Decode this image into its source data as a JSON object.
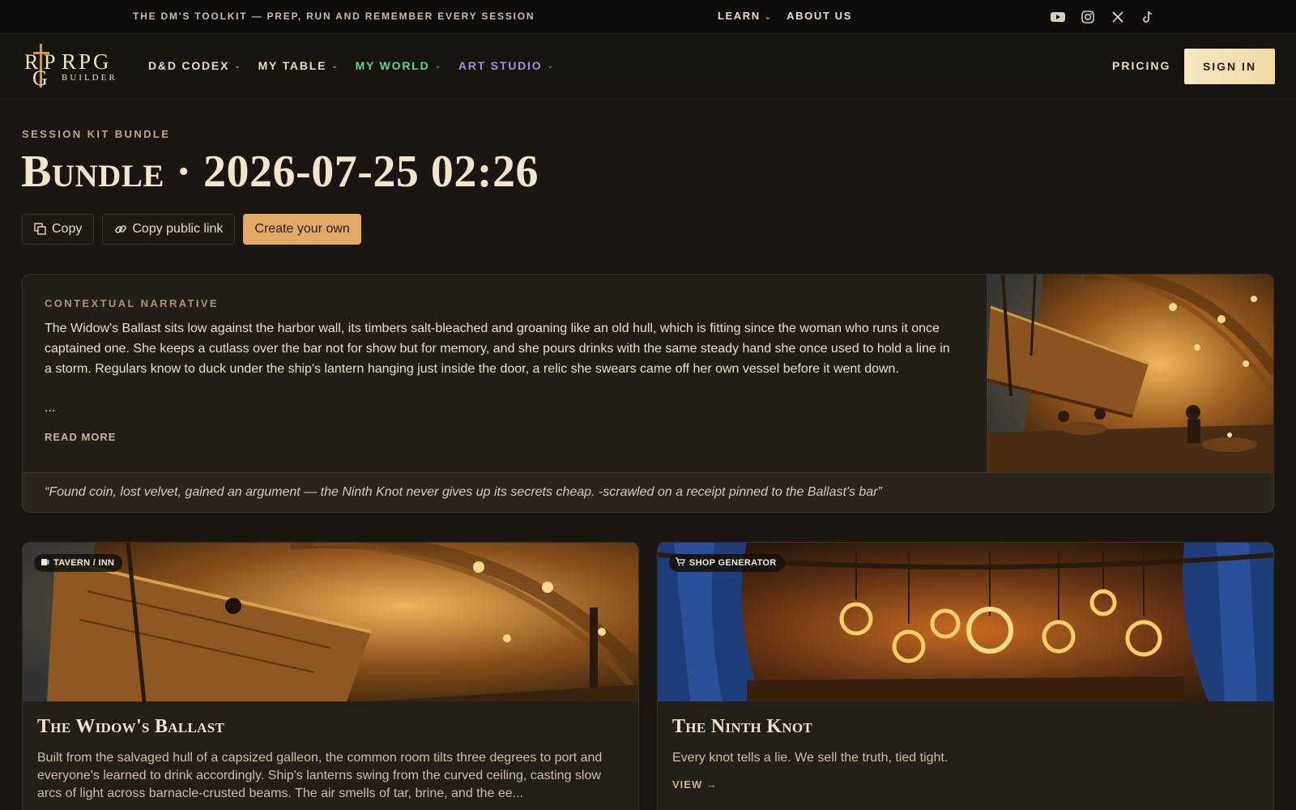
{
  "topbar": {
    "tagline": "THE DM'S TOOLKIT — PREP, RUN AND REMEMBER EVERY SESSION",
    "links": [
      "LEARN",
      "ABOUT US"
    ],
    "socials": [
      "youtube-icon",
      "instagram-icon",
      "x-icon",
      "tiktok-icon"
    ]
  },
  "nav": {
    "logo": {
      "mono": [
        "R",
        "P",
        "G"
      ],
      "word1": "RPG",
      "word2": "BUILDER"
    },
    "items": [
      {
        "label": "D&D CODEX",
        "color": "#e8dcc6"
      },
      {
        "label": "MY TABLE",
        "color": "#e8dcc6"
      },
      {
        "label": "MY WORLD",
        "color": "#6fcf8f"
      },
      {
        "label": "ART STUDIO",
        "color": "#a98fe0"
      }
    ],
    "pricing": "PRICING",
    "signin": "SIGN IN"
  },
  "header": {
    "kicker": "SESSION KIT BUNDLE",
    "title": "Bundle · 2026-07-25 02:26",
    "actions": {
      "copy": "Copy",
      "copy_link": "Copy public link",
      "create": "Create your own"
    }
  },
  "narrative": {
    "label": "CONTEXTUAL NARRATIVE",
    "body": "The Widow's Ballast sits low against the harbor wall, its timbers salt-bleached and groaning like an old hull, which is fitting since the woman who runs it once captained one. She keeps a cutlass over the bar not for show but for memory, and she pours drinks with the same steady hand she once used to hold a line in a storm. Regulars know to duck under the ship's lantern hanging just inside the door, a relic she swears came off her own vessel before it went down.",
    "ellipsis": "...",
    "read_more": "READ MORE",
    "quote": "“Found coin, lost velvet, gained an argument — the Ninth Knot never gives up its secrets cheap. -scrawled on a receipt pinned to the Ballast's bar”"
  },
  "cards": [
    {
      "badge": "TAVERN / INN",
      "badge_icon": "beer-mug-icon",
      "title": "The Widow's Ballast",
      "desc": "Built from the salvaged hull of a capsized galleon, the common room tilts three degrees to port and everyone's learned to drink accordingly. Ship's lanterns swing from the curved ceiling, casting slow arcs of light across barnacle-crusted beams. The air smells of tar, brine, and the ee..."
    },
    {
      "badge": "SHOP GENERATOR",
      "badge_icon": "cart-icon",
      "title": "The Ninth Knot",
      "desc": "Every knot tells a lie. We sell the truth, tied tight.",
      "view": "VIEW →"
    }
  ]
}
